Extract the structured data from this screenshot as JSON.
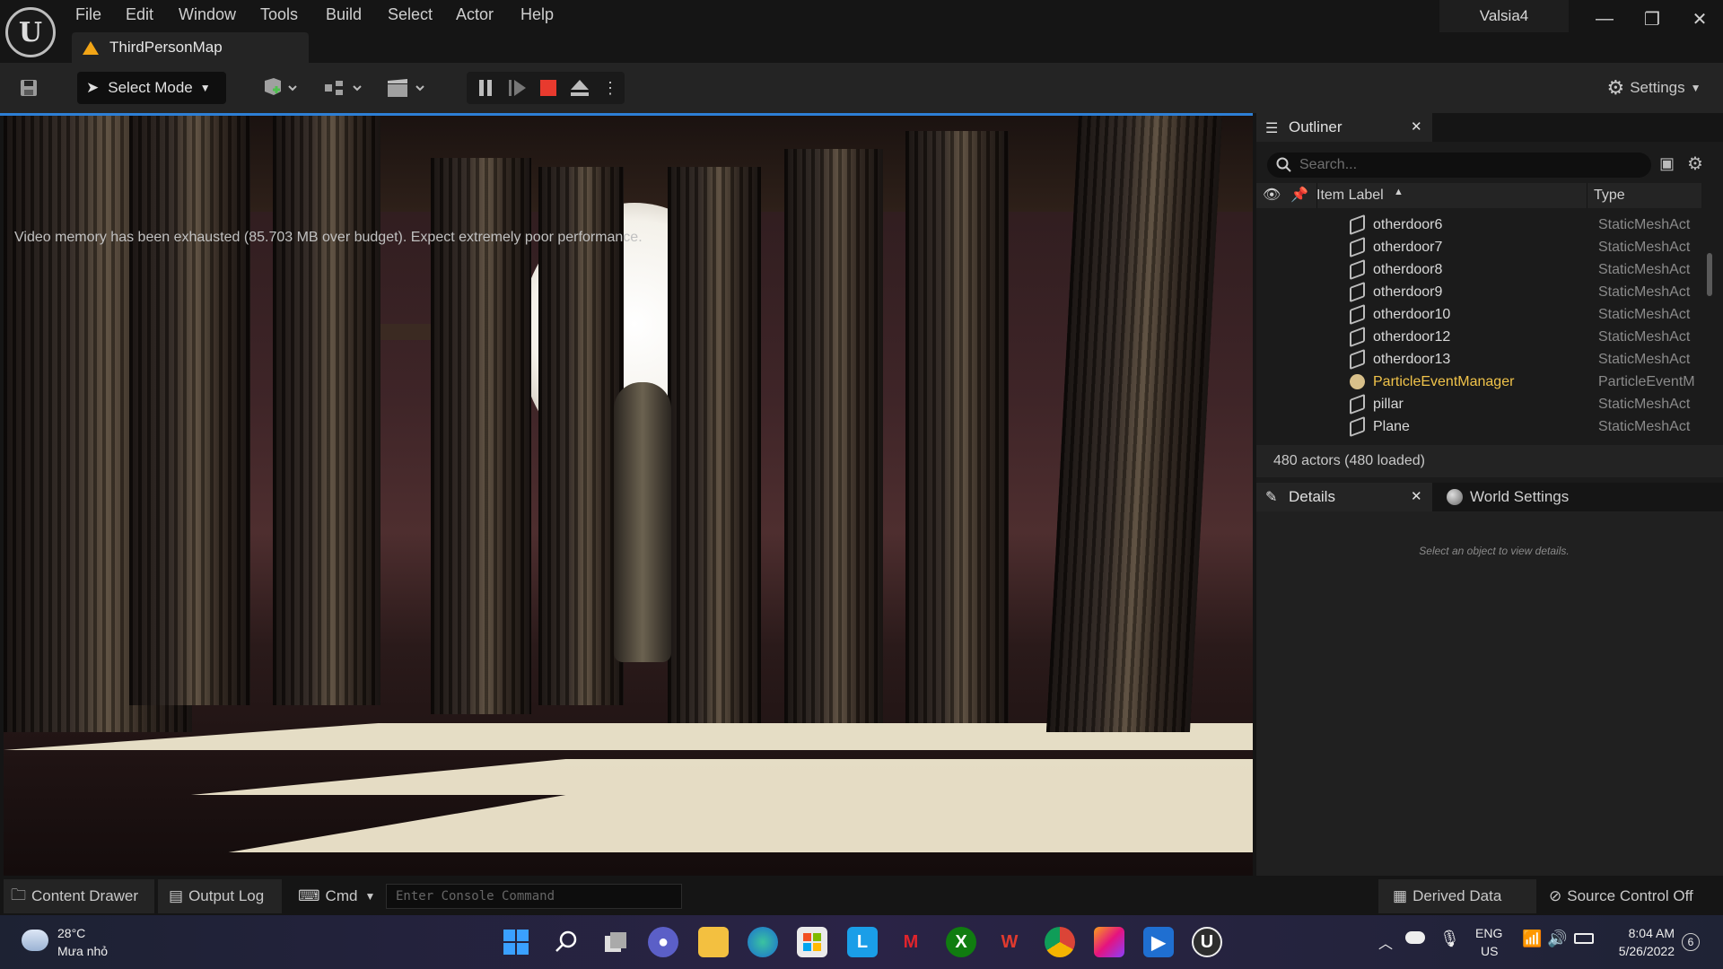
{
  "menu": [
    "File",
    "Edit",
    "Window",
    "Tools",
    "Build",
    "Select",
    "Actor",
    "Help"
  ],
  "map_tab": "ThirdPersonMap",
  "project_name": "Valsia4",
  "window_controls": {
    "minimize": "—",
    "maximize": "❐",
    "close": "✕"
  },
  "toolbar": {
    "select_mode": "Select Mode",
    "settings": "Settings"
  },
  "viewport": {
    "warning": "Video memory has been exhausted (85.703 MB over budget). Expect extremely poor performance."
  },
  "outliner": {
    "tab_label": "Outliner",
    "search_placeholder": "Search...",
    "col_label": "Item Label",
    "col_type": "Type",
    "rows": [
      {
        "label": "otherdoor6",
        "type": "StaticMeshAct"
      },
      {
        "label": "otherdoor7",
        "type": "StaticMeshAct"
      },
      {
        "label": "otherdoor8",
        "type": "StaticMeshAct"
      },
      {
        "label": "otherdoor9",
        "type": "StaticMeshAct"
      },
      {
        "label": "otherdoor10",
        "type": "StaticMeshAct"
      },
      {
        "label": "otherdoor12",
        "type": "StaticMeshAct"
      },
      {
        "label": "otherdoor13",
        "type": "StaticMeshAct"
      },
      {
        "label": "ParticleEventManager",
        "type": "ParticleEventM"
      },
      {
        "label": "pillar",
        "type": "StaticMeshAct"
      },
      {
        "label": "Plane",
        "type": "StaticMeshAct"
      }
    ],
    "actor_count": "480 actors (480 loaded)"
  },
  "details": {
    "tab_label": "Details",
    "world_settings": "World Settings",
    "empty_message": "Select an object to view details."
  },
  "statusbar": {
    "content_drawer": "Content Drawer",
    "output_log": "Output Log",
    "cmd": "Cmd",
    "console_placeholder": "Enter Console Command",
    "derived_data": "Derived Data",
    "source_control": "Source Control Off"
  },
  "taskbar": {
    "temperature": "28°C",
    "weather": "Mưa nhỏ",
    "lang": "ENG",
    "region": "US",
    "time": "8:04 AM",
    "date": "5/26/2022",
    "notifications": "6"
  },
  "colors": {
    "accent": "#2d7fd6",
    "warning_text": "#ff3b2f",
    "stop_button": "#e83a2e",
    "particle_label": "#f0c34a"
  }
}
